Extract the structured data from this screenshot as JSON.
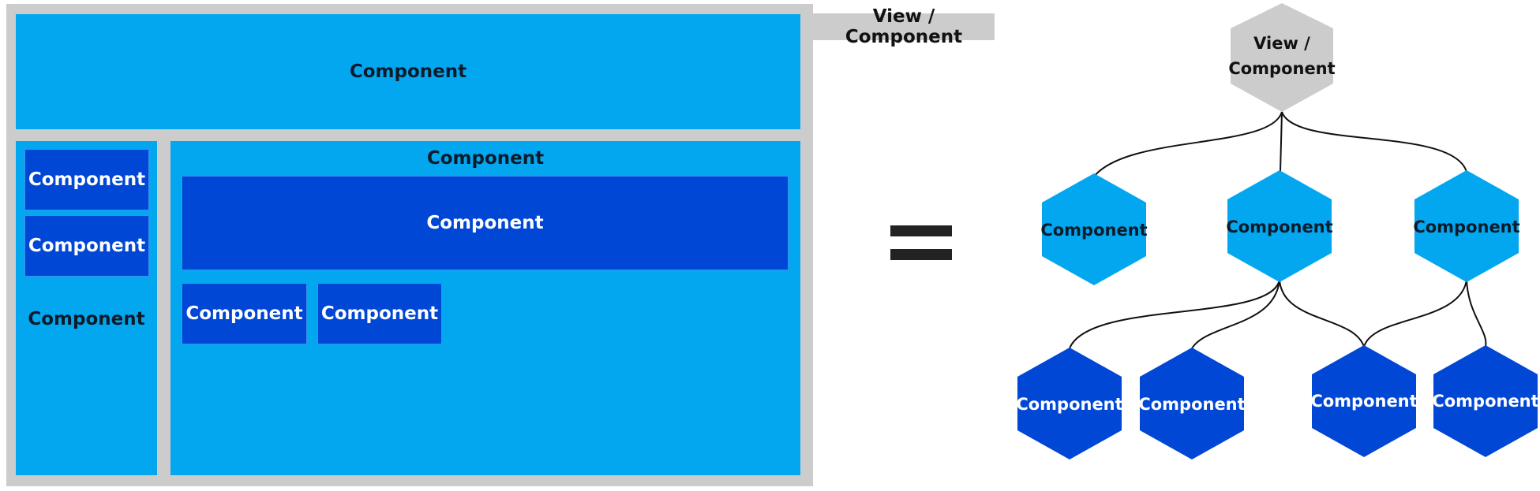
{
  "colors": {
    "grey": "#cccccc",
    "light_blue": "#03a7ef",
    "dark_blue": "#0047d5",
    "line": "#111111",
    "equals": "#222222"
  },
  "layout_diagram": {
    "view_label": "View / Component",
    "header_label": "Component",
    "sidebar_label": "Component",
    "sidebar_items": [
      "Component",
      "Component"
    ],
    "main_label": "Component",
    "main_banner_label": "Component",
    "main_items": [
      "Component",
      "Component"
    ]
  },
  "equals_sign": "=",
  "tree_diagram": {
    "root_lines": [
      "View /",
      "Component"
    ],
    "level1": [
      "Component",
      "Component",
      "Component"
    ],
    "level2": [
      "Component",
      "Component",
      "Component",
      "Component"
    ]
  }
}
